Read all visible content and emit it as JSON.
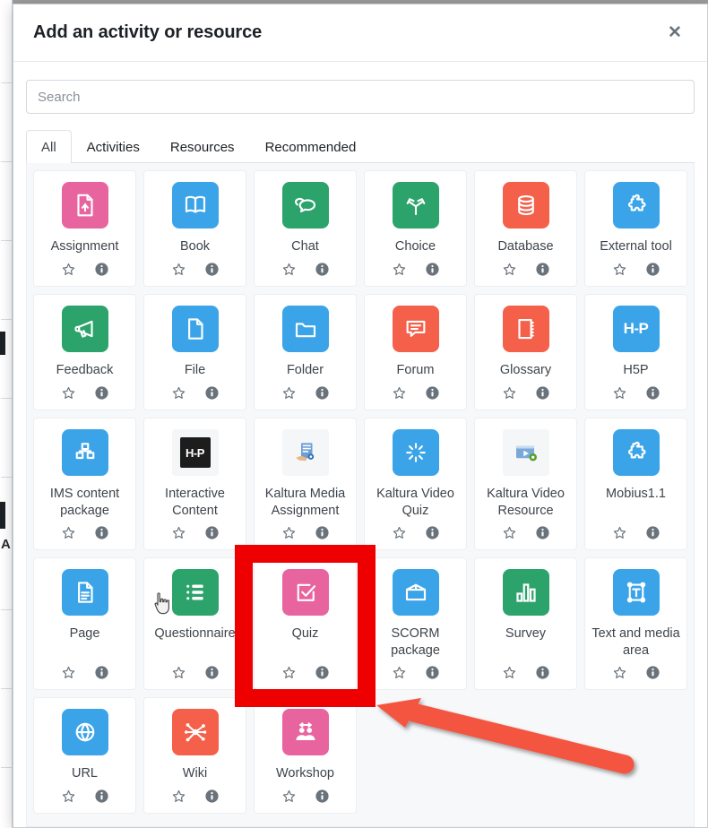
{
  "modal": {
    "title": "Add an activity or resource",
    "close_label": "✕",
    "close_icon": "close-icon"
  },
  "search": {
    "placeholder": "Search",
    "value": ""
  },
  "tabs": [
    {
      "label": "All",
      "active": true
    },
    {
      "label": "Activities",
      "active": false
    },
    {
      "label": "Resources",
      "active": false
    },
    {
      "label": "Recommended",
      "active": false
    }
  ],
  "card_actions": {
    "star_icon": "star-outline-icon",
    "star_title": "Add to favourites",
    "info_icon": "info-circle-icon",
    "info_title": "Help with this activity"
  },
  "items": [
    {
      "label": "Assignment",
      "icon": "assignment-icon",
      "color": "#e8649f",
      "style": "tile"
    },
    {
      "label": "Book",
      "icon": "book-icon",
      "color": "#3ba4e8",
      "style": "tile"
    },
    {
      "label": "Chat",
      "icon": "chat-bubbles-icon",
      "color": "#2ba36b",
      "style": "tile"
    },
    {
      "label": "Choice",
      "icon": "choice-fork-icon",
      "color": "#2ba36b",
      "style": "tile"
    },
    {
      "label": "Database",
      "icon": "database-icon",
      "color": "#f4604a",
      "style": "tile"
    },
    {
      "label": "External tool",
      "icon": "puzzle-piece-icon",
      "color": "#3ba4e8",
      "style": "tile"
    },
    {
      "label": "Feedback",
      "icon": "megaphone-icon",
      "color": "#2ba36b",
      "style": "tile"
    },
    {
      "label": "File",
      "icon": "file-page-icon",
      "color": "#3ba4e8",
      "style": "tile"
    },
    {
      "label": "Folder",
      "icon": "folder-icon",
      "color": "#3ba4e8",
      "style": "tile"
    },
    {
      "label": "Forum",
      "icon": "forum-comment-icon",
      "color": "#f4604a",
      "style": "tile"
    },
    {
      "label": "Glossary",
      "icon": "glossary-book-icon",
      "color": "#f4604a",
      "style": "tile"
    },
    {
      "label": "H5P",
      "icon": "h5p-logo-icon",
      "color": "#3ba4e8",
      "style": "tile",
      "text": "H-P"
    },
    {
      "label": "IMS content package",
      "icon": "ims-package-icon",
      "color": "#3ba4e8",
      "style": "tile"
    },
    {
      "label": "Interactive Content",
      "icon": "h5p-black-logo-icon",
      "color": "#f5f6f8",
      "style": "plain",
      "text": "H-P"
    },
    {
      "label": "Kaltura Media Assignment",
      "icon": "kaltura-media-assignment-icon",
      "color": "#f5f6f8",
      "style": "plain"
    },
    {
      "label": "Kaltura Video Quiz",
      "icon": "kaltura-video-quiz-icon",
      "color": "#3ba4e8",
      "style": "tile"
    },
    {
      "label": "Kaltura Video Resource",
      "icon": "kaltura-video-resource-icon",
      "color": "#f5f6f8",
      "style": "plain"
    },
    {
      "label": "Mobius1.1",
      "icon": "puzzle-piece-icon",
      "color": "#3ba4e8",
      "style": "tile"
    },
    {
      "label": "Page",
      "icon": "page-document-icon",
      "color": "#3ba4e8",
      "style": "tile"
    },
    {
      "label": "Questionnaire",
      "icon": "questionnaire-list-icon",
      "color": "#2ba36b",
      "style": "tile"
    },
    {
      "label": "Quiz",
      "icon": "quiz-checkbox-icon",
      "color": "#e8649f",
      "style": "tile",
      "highlighted": true
    },
    {
      "label": "SCORM package",
      "icon": "scorm-box-icon",
      "color": "#3ba4e8",
      "style": "tile"
    },
    {
      "label": "Survey",
      "icon": "survey-bars-icon",
      "color": "#2ba36b",
      "style": "tile"
    },
    {
      "label": "Text and media area",
      "icon": "text-media-area-icon",
      "color": "#3ba4e8",
      "style": "tile"
    },
    {
      "label": "URL",
      "icon": "globe-link-icon",
      "color": "#3ba4e8",
      "style": "tile"
    },
    {
      "label": "Wiki",
      "icon": "wiki-network-icon",
      "color": "#f4604a",
      "style": "tile"
    },
    {
      "label": "Workshop",
      "icon": "workshop-people-icon",
      "color": "#e8649f",
      "style": "tile"
    }
  ],
  "annotations": {
    "highlight_color": "#ee0000",
    "highlight_target": "Quiz",
    "arrow_color": "#f4543f",
    "cursor_icon": "pointer-hand-cursor"
  }
}
